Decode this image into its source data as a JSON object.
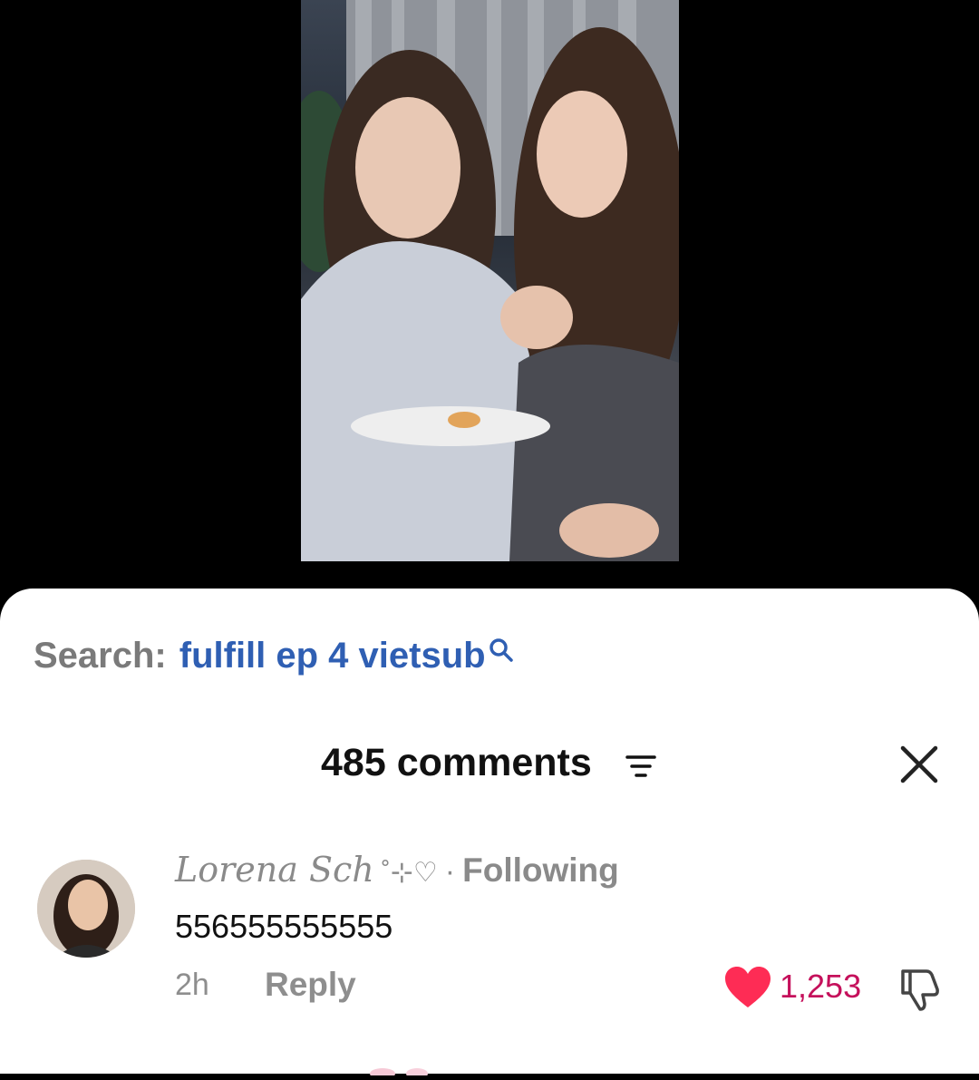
{
  "video": {
    "label": "video-thumbnail"
  },
  "search": {
    "label": "Search:",
    "query": "fulfill ep 4 vietsub",
    "icon": "search-icon"
  },
  "comments_header": {
    "title": "485 comments",
    "sort_icon": "sort-icon",
    "close_icon": "close-icon"
  },
  "comment": {
    "username": "Lorena Sch",
    "decoration": "˚⊹♡",
    "separator": "·",
    "following": "Following",
    "text": "556555555555",
    "time": "2h",
    "reply": "Reply",
    "likes": "1,253",
    "like_color": "#fe2c55"
  }
}
